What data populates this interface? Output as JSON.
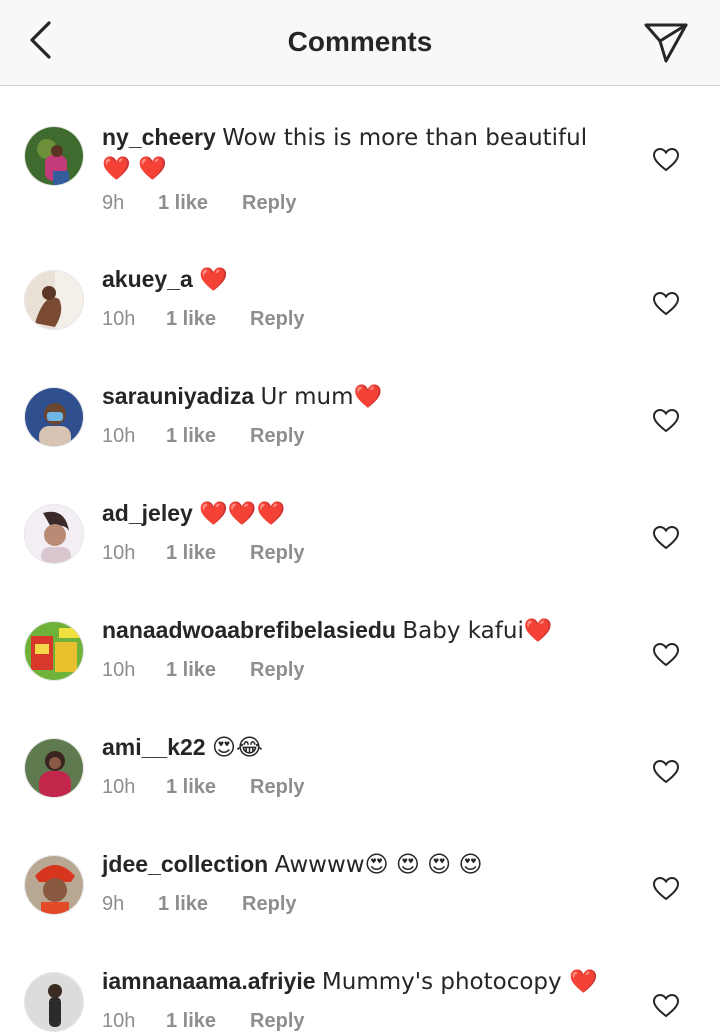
{
  "header": {
    "title": "Comments"
  },
  "comments": [
    {
      "username": "ny_cheery",
      "text": "Wow this is more than beautiful ❤️ ❤️",
      "time": "9h",
      "likes": "1 like",
      "reply": "Reply"
    },
    {
      "username": "akuey_a",
      "text": "❤️",
      "time": "10h",
      "likes": "1 like",
      "reply": "Reply"
    },
    {
      "username": "sarauniyadiza",
      "text": "Ur mum❤️",
      "time": "10h",
      "likes": "1 like",
      "reply": "Reply"
    },
    {
      "username": "ad_jeley",
      "text": "❤️❤️❤️",
      "time": "10h",
      "likes": "1 like",
      "reply": "Reply"
    },
    {
      "username": "nanaadwoaabrefibelasiedu",
      "text": "Baby kafui❤️",
      "time": "10h",
      "likes": "1 like",
      "reply": "Reply"
    },
    {
      "username": "ami__k22",
      "text": "😍😂",
      "time": "10h",
      "likes": "1 like",
      "reply": "Reply"
    },
    {
      "username": "jdee_collection",
      "text": "Awwww😍 😍 😍 😍",
      "time": "9h",
      "likes": "1 like",
      "reply": "Reply"
    },
    {
      "username": "iamnanaama.afriyie",
      "text": "Mummy's photocopy ❤️",
      "time": "10h",
      "likes": "1 like",
      "reply": "Reply"
    }
  ],
  "icons": {
    "back": "chevron-left-icon",
    "send": "paper-plane-icon",
    "like": "heart-outline-icon"
  },
  "colors": {
    "text": "#262626",
    "meta": "#8e8e8e",
    "header_bg": "#f8f8f8",
    "divider": "#cfcfcf"
  }
}
